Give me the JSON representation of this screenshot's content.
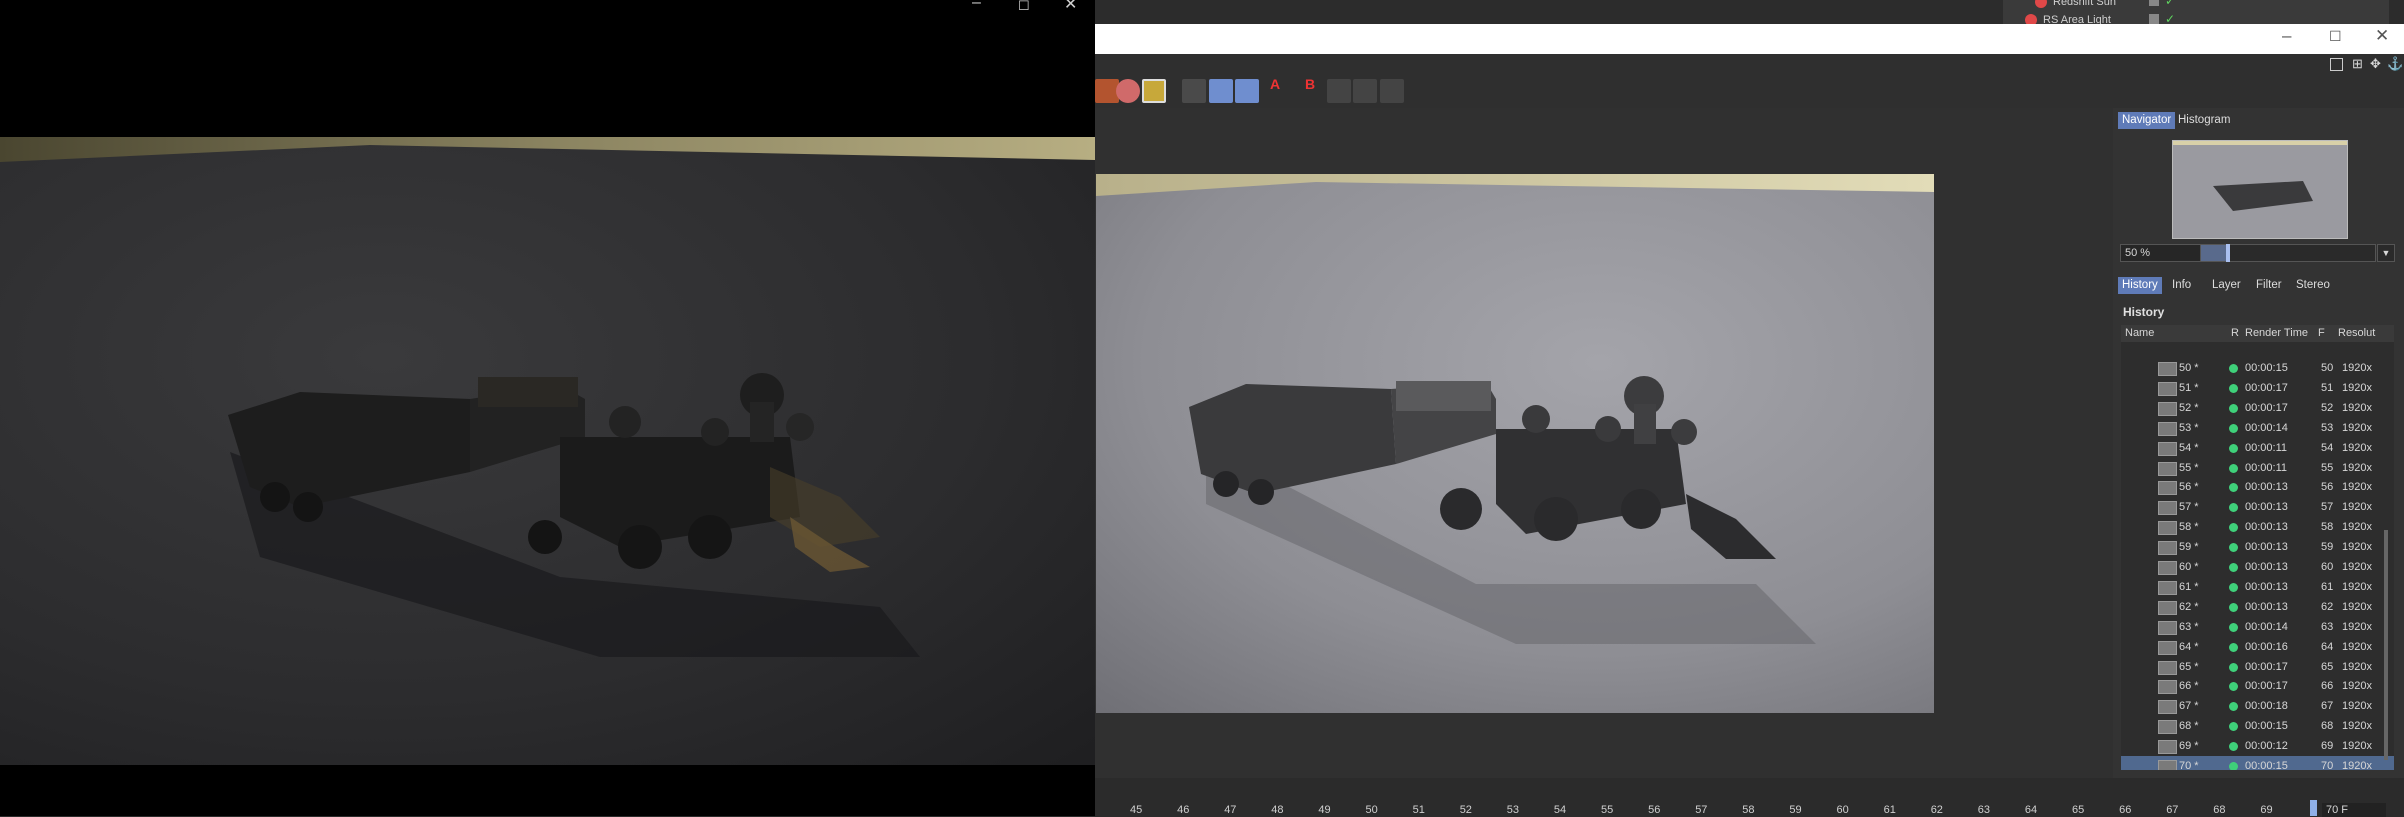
{
  "left_viewport": {
    "window_controls": {
      "minimize": "‒",
      "maximize": "☐",
      "close": "✕"
    }
  },
  "object_manager": {
    "items": [
      {
        "label": "Redshift Sun"
      },
      {
        "label": "RS Area Light"
      }
    ]
  },
  "picture_viewer": {
    "window_controls": {
      "minimize": "‒",
      "maximize": "☐",
      "close": "✕"
    },
    "side_tabs_top": [
      "Navigator",
      "Histogram"
    ],
    "zoom": {
      "value": "50 %",
      "level_percent": 50
    },
    "side_tabs": [
      "History",
      "Info",
      "Layer",
      "Filter",
      "Stereo"
    ],
    "history": {
      "title": "History",
      "columns": [
        "Name",
        "R",
        "Render Time",
        "F",
        "Resolut"
      ],
      "rows": [
        {
          "name": "50 *",
          "time": "00:00:15",
          "frame": "50",
          "res": "1920x"
        },
        {
          "name": "51 *",
          "time": "00:00:17",
          "frame": "51",
          "res": "1920x"
        },
        {
          "name": "52 *",
          "time": "00:00:17",
          "frame": "52",
          "res": "1920x"
        },
        {
          "name": "53 *",
          "time": "00:00:14",
          "frame": "53",
          "res": "1920x"
        },
        {
          "name": "54 *",
          "time": "00:00:11",
          "frame": "54",
          "res": "1920x"
        },
        {
          "name": "55 *",
          "time": "00:00:11",
          "frame": "55",
          "res": "1920x"
        },
        {
          "name": "56 *",
          "time": "00:00:13",
          "frame": "56",
          "res": "1920x"
        },
        {
          "name": "57 *",
          "time": "00:00:13",
          "frame": "57",
          "res": "1920x"
        },
        {
          "name": "58 *",
          "time": "00:00:13",
          "frame": "58",
          "res": "1920x"
        },
        {
          "name": "59 *",
          "time": "00:00:13",
          "frame": "59",
          "res": "1920x"
        },
        {
          "name": "60 *",
          "time": "00:00:13",
          "frame": "60",
          "res": "1920x"
        },
        {
          "name": "61 *",
          "time": "00:00:13",
          "frame": "61",
          "res": "1920x"
        },
        {
          "name": "62 *",
          "time": "00:00:13",
          "frame": "62",
          "res": "1920x"
        },
        {
          "name": "63 *",
          "time": "00:00:14",
          "frame": "63",
          "res": "1920x"
        },
        {
          "name": "64 *",
          "time": "00:00:16",
          "frame": "64",
          "res": "1920x"
        },
        {
          "name": "65 *",
          "time": "00:00:17",
          "frame": "65",
          "res": "1920x"
        },
        {
          "name": "66 *",
          "time": "00:00:17",
          "frame": "66",
          "res": "1920x"
        },
        {
          "name": "67 *",
          "time": "00:00:18",
          "frame": "67",
          "res": "1920x"
        },
        {
          "name": "68 *",
          "time": "00:00:15",
          "frame": "68",
          "res": "1920x"
        },
        {
          "name": "69 *",
          "time": "00:00:12",
          "frame": "69",
          "res": "1920x"
        },
        {
          "name": "70 *",
          "time": "00:00:15",
          "frame": "70",
          "res": "1920x"
        }
      ],
      "selected_frame": "70"
    }
  },
  "timeline": {
    "ticks": [
      "45",
      "46",
      "47",
      "48",
      "49",
      "50",
      "51",
      "52",
      "53",
      "54",
      "55",
      "56",
      "57",
      "58",
      "59",
      "60",
      "61",
      "62",
      "63",
      "64",
      "65",
      "66",
      "67",
      "68",
      "69"
    ],
    "current_frame": "70 F"
  },
  "colors": {
    "accent": "#5f7bb8",
    "status_ok": "#3fd07a",
    "sky": "#cfc7a0"
  }
}
